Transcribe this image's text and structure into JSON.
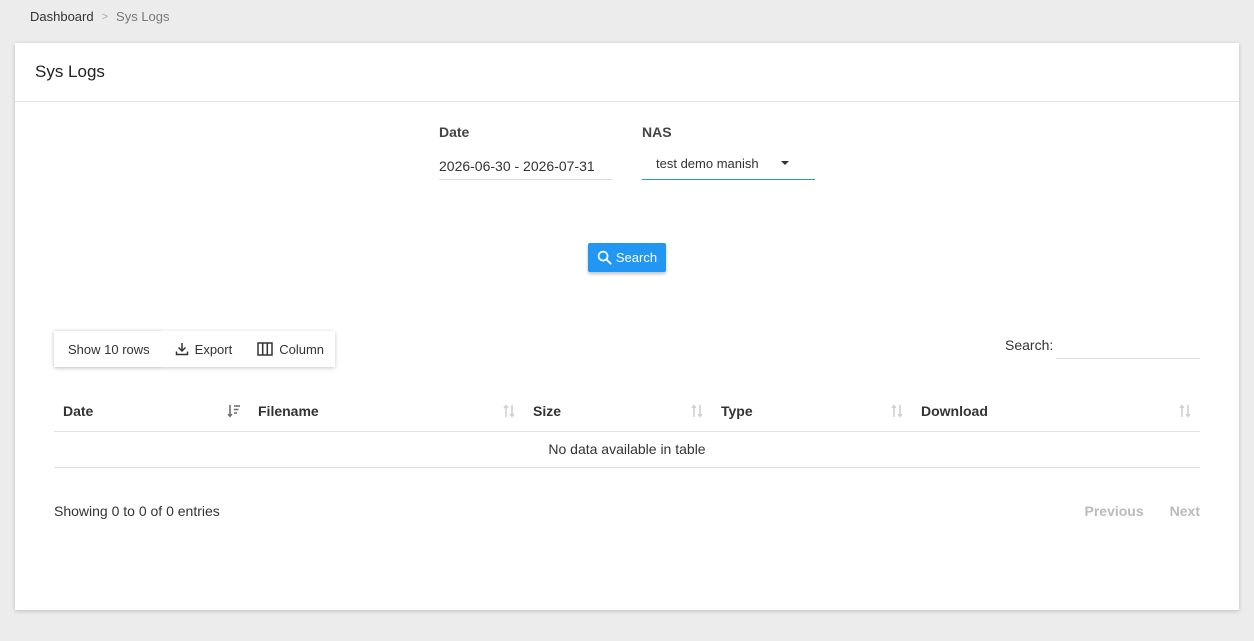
{
  "breadcrumb": {
    "home": "Dashboard",
    "separator": ">",
    "current": "Sys Logs"
  },
  "card": {
    "title": "Sys Logs"
  },
  "filters": {
    "date_label": "Date",
    "date_value": "2026-06-30 - 2026-07-31",
    "nas_label": "NAS",
    "nas_value": "test demo manish"
  },
  "search_button": {
    "label": "Search",
    "icon": "search-icon"
  },
  "toolbar": {
    "show_rows": "Show 10 rows",
    "export": "Export",
    "column": "Column"
  },
  "table_search": {
    "label": "Search:",
    "value": ""
  },
  "table": {
    "columns": [
      "Date",
      "Filename",
      "Size",
      "Type",
      "Download"
    ],
    "empty_message": "No data available in table"
  },
  "footer": {
    "info": "Showing 0 to 0 of 0 entries",
    "previous": "Previous",
    "next": "Next"
  },
  "colors": {
    "accent": "#2196f3",
    "background": "#ececec"
  }
}
